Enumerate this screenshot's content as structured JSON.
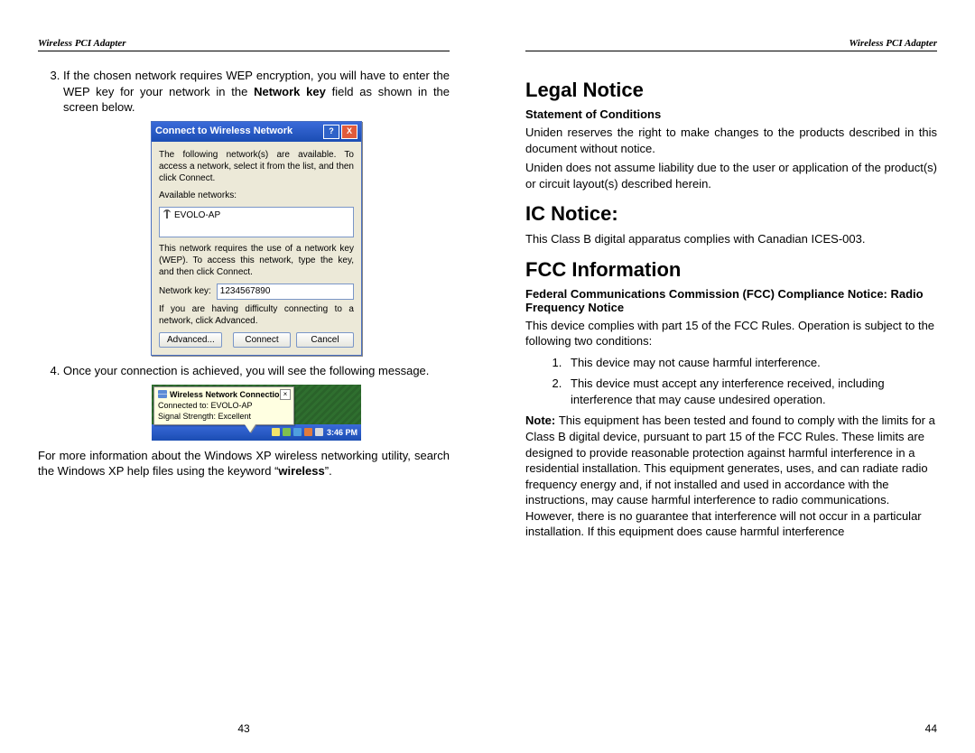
{
  "header": "Wireless  PCI  Adapter",
  "left": {
    "pagenum": "43",
    "step3": {
      "pre": "If the chosen network requires WEP encryption, you will have to enter the WEP key for your network in the ",
      "bold": "Network key",
      "post": " field as shown in the screen below."
    },
    "dialog1": {
      "title": "Connect to Wireless Network",
      "help": "?",
      "close": "X",
      "line1": "The following network(s) are available. To access a network, select it from the list, and then click Connect.",
      "avail": "Available networks:",
      "ssid": "EVOLO-AP",
      "line2": "This network requires the use of a network key (WEP). To access this network, type the key, and then click Connect.",
      "netkey_label": "Network key:",
      "netkey_value": "1234567890",
      "line3": "If you are having difficulty connecting to a network, click Advanced.",
      "btn_adv": "Advanced...",
      "btn_connect": "Connect",
      "btn_cancel": "Cancel"
    },
    "step4": "Once your connection is achieved, you will see the following message.",
    "dialog2": {
      "balloon_title": "Wireless Network Connection",
      "balloon_l1": "Connected to: EVOLO-AP",
      "balloon_l2": "Signal Strength: Excellent",
      "clock": "3:46 PM"
    },
    "closing": {
      "pre": "For more information about the Windows XP wireless networking utility, search the Windows XP help files using the keyword “",
      "bold": "wireless",
      "post": "”."
    }
  },
  "right": {
    "pagenum": "44",
    "legal_h": "Legal Notice",
    "soc_h": "Statement of Conditions",
    "soc_p1": "Uniden reserves the right to make changes to the products described in this document without notice.",
    "soc_p2": "Uniden does not assume liability due to the user or application of the product(s) or circuit layout(s) described herein.",
    "ic_h": "IC Notice:",
    "ic_p": "This Class B digital apparatus complies with Canadian ICES-003.",
    "fcc_h": "FCC Information",
    "fcc_sub": "Federal Communications Commission (FCC) Compliance Notice: Radio Frequency Notice",
    "fcc_p": "This device complies with part 15 of the FCC Rules. Operation is subject to the following two conditions:",
    "fcc_1": "This device may not cause harmful interference.",
    "fcc_2": "This device must accept any interference received, including interference that may cause undesired operation.",
    "note_lead": "Note: ",
    "note_body": "This equipment has been tested and found to comply with the limits for a Class B digital device, pursuant to part 15 of the FCC Rules. These limits are designed to provide reasonable protection against harmful interference in a residential installation. This equipment generates, uses, and can radiate radio frequency energy and, if not installed and used in accordance with the instructions, may cause harmful interference to radio communications. However, there is no guarantee that interference will not occur in a particular installation. If this equipment does cause harmful interference"
  }
}
